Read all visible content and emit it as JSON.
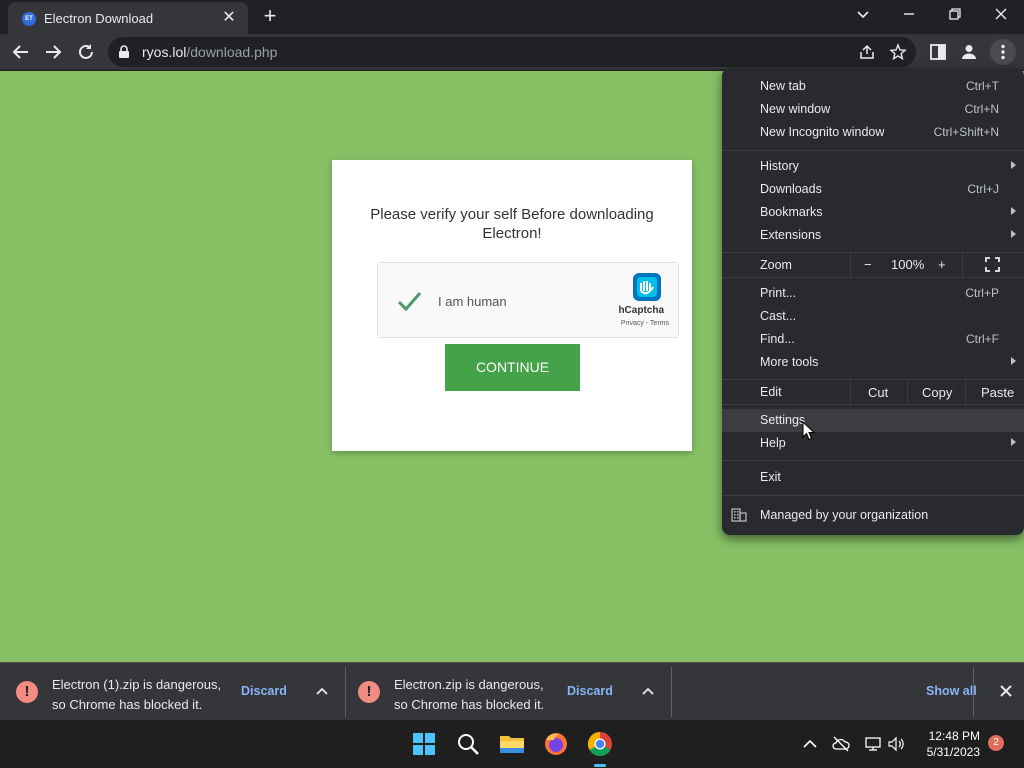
{
  "tab": {
    "favicon_text": "ET",
    "title": "Electron Download"
  },
  "address": {
    "host": "ryos.lol",
    "path": "/download.php"
  },
  "page": {
    "heading": "Please verify your self Before downloading Electron!",
    "captcha_label": "I am human",
    "captcha_brand": "hCaptcha",
    "captcha_links": "Privacy - Terms",
    "continue_label": "CONTINUE"
  },
  "menu": {
    "new_tab": "New tab",
    "new_tab_sc": "Ctrl+T",
    "new_window": "New window",
    "new_window_sc": "Ctrl+N",
    "new_incognito": "New Incognito window",
    "new_incognito_sc": "Ctrl+Shift+N",
    "history": "History",
    "downloads": "Downloads",
    "downloads_sc": "Ctrl+J",
    "bookmarks": "Bookmarks",
    "extensions": "Extensions",
    "zoom": "Zoom",
    "zoom_minus": "−",
    "zoom_level": "100%",
    "zoom_plus": "+",
    "print": "Print...",
    "print_sc": "Ctrl+P",
    "cast": "Cast...",
    "find": "Find...",
    "find_sc": "Ctrl+F",
    "more_tools": "More tools",
    "edit": "Edit",
    "cut": "Cut",
    "copy": "Copy",
    "paste": "Paste",
    "settings": "Settings",
    "help": "Help",
    "exit": "Exit",
    "managed": "Managed by your organization"
  },
  "downloads": [
    {
      "line1": "Electron (1).zip is dangerous,",
      "line2": "so Chrome has blocked it.",
      "discard": "Discard"
    },
    {
      "line1": "Electron.zip is dangerous,",
      "line2": "so Chrome has blocked it.",
      "discard": "Discard"
    }
  ],
  "shelf": {
    "show_all": "Show all"
  },
  "taskbar": {
    "time": "12:48 PM",
    "date": "5/31/2023",
    "notifications": "2"
  },
  "colors": {
    "page_bg": "#86c065",
    "continue_bg": "#44a248",
    "menu_bg": "#292a2d",
    "link": "#8ab4f8"
  }
}
